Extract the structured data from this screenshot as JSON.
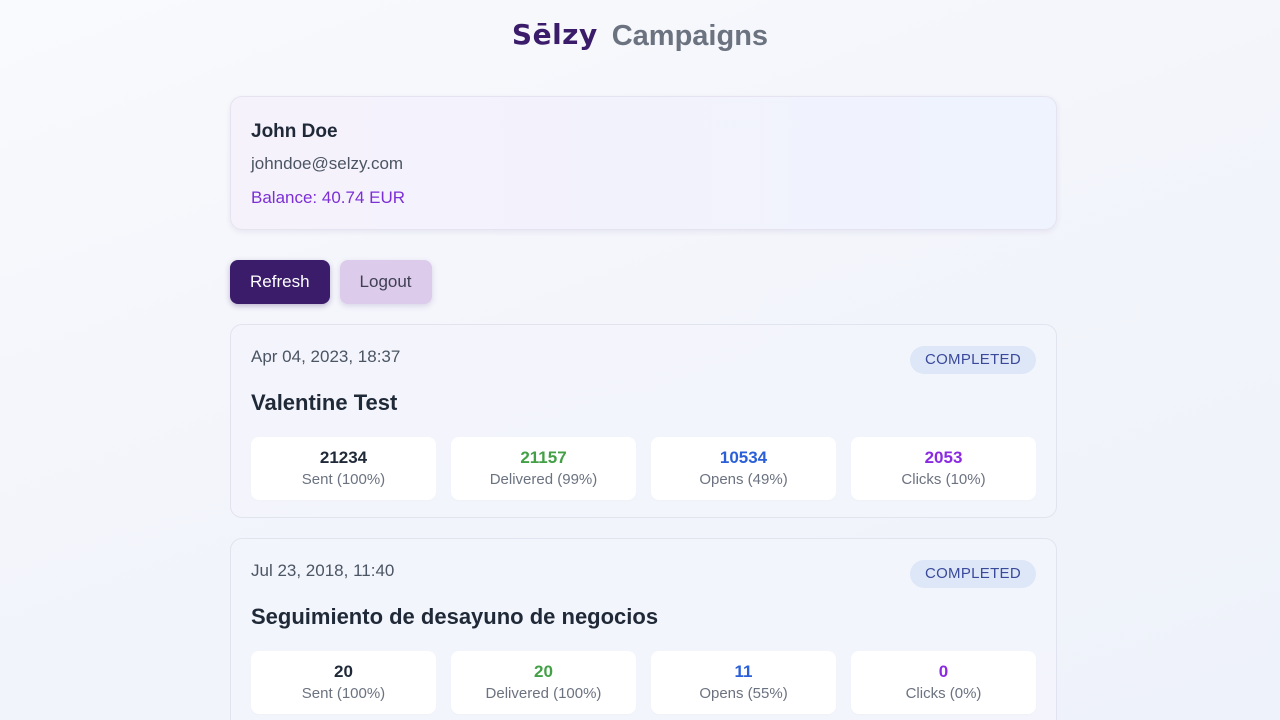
{
  "header": {
    "logo": "Sēlzy",
    "title": "Campaigns"
  },
  "profile": {
    "name": "John Doe",
    "email": "johndoe@selzy.com",
    "balance": "Balance: 40.74 EUR"
  },
  "actions": {
    "refresh_label": "Refresh",
    "logout_label": "Logout"
  },
  "campaigns": [
    {
      "date": "Apr 04, 2023, 18:37",
      "status": "COMPLETED",
      "title": "Valentine Test",
      "stats": {
        "sent": {
          "value": "21234",
          "label": "Sent (100%)"
        },
        "delivered": {
          "value": "21157",
          "label": "Delivered (99%)"
        },
        "opens": {
          "value": "10534",
          "label": "Opens (49%)"
        },
        "clicks": {
          "value": "2053",
          "label": "Clicks (10%)"
        }
      }
    },
    {
      "date": "Jul 23, 2018, 11:40",
      "status": "COMPLETED",
      "title": "Seguimiento de desayuno de negocios",
      "stats": {
        "sent": {
          "value": "20",
          "label": "Sent (100%)"
        },
        "delivered": {
          "value": "20",
          "label": "Delivered (100%)"
        },
        "opens": {
          "value": "11",
          "label": "Opens (55%)"
        },
        "clicks": {
          "value": "0",
          "label": "Clicks (0%)"
        }
      }
    }
  ],
  "colors": {
    "brand": "#3b1c6b",
    "balance": "#7c2fd6",
    "delivered": "#43a047",
    "opens": "#2b5fd9",
    "clicks": "#8a2be2",
    "badge_bg": "#dde7f8"
  }
}
